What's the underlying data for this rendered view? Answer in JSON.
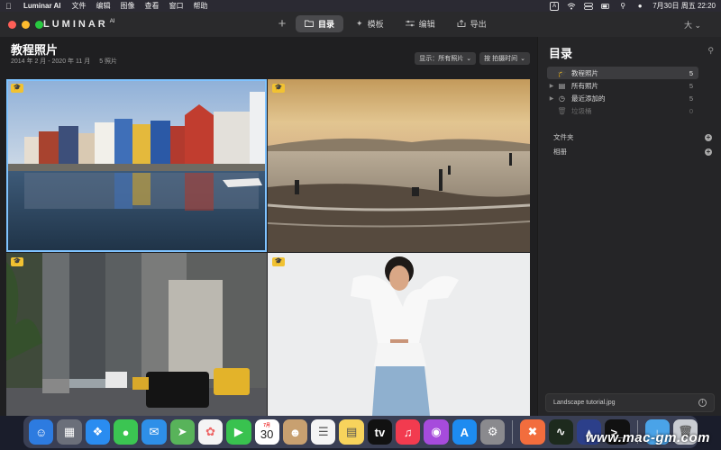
{
  "menubar": {
    "app": "Luminar AI",
    "items": [
      "文件",
      "编辑",
      "图像",
      "查看",
      "窗口",
      "帮助"
    ],
    "input_badge": "A",
    "datetime": "7月30日 周五  22:20"
  },
  "titlebar": {
    "logo": "LUMINAR",
    "logo_sup": "AI",
    "tabs": [
      {
        "label": "目录",
        "icon": "folder-icon"
      },
      {
        "label": "模板",
        "icon": "sparkle-icon"
      },
      {
        "label": "编辑",
        "icon": "sliders-icon"
      },
      {
        "label": "导出",
        "icon": "export-icon"
      }
    ],
    "user": "大"
  },
  "main": {
    "title": "教程照片",
    "date_range": "2014 年 2 月 - 2020 年 11 月",
    "count": "5 照片",
    "show_filter": "显示：所有照片",
    "sort_filter": "按 拍摄时间"
  },
  "photos": [
    {
      "name": "canal-houses",
      "badge": true,
      "selected": true
    },
    {
      "name": "beach-sunset",
      "badge": true,
      "selected": false
    },
    {
      "name": "city-street",
      "badge": true,
      "selected": false
    },
    {
      "name": "woman-portrait",
      "badge": true,
      "selected": false
    }
  ],
  "panel": {
    "title": "目录",
    "items": [
      {
        "label": "教程照片",
        "count": "5",
        "icon": "graduation-cap-icon"
      },
      {
        "label": "所有照片",
        "count": "5",
        "icon": "photos-icon"
      },
      {
        "label": "最近添加的",
        "count": "5",
        "icon": "recent-icon"
      },
      {
        "label": "垃圾桶",
        "count": "0",
        "icon": "trash-icon"
      }
    ],
    "folders": "文件夹",
    "albums": "相册",
    "selected_file": "Landscape tutorial.jpg"
  },
  "dock": {
    "calendar_month": "7月",
    "calendar_day": "30"
  },
  "watermark": "www.mac-gm.com",
  "colors": {
    "accent": "#7fc3ff",
    "badge": "#f1c232"
  }
}
